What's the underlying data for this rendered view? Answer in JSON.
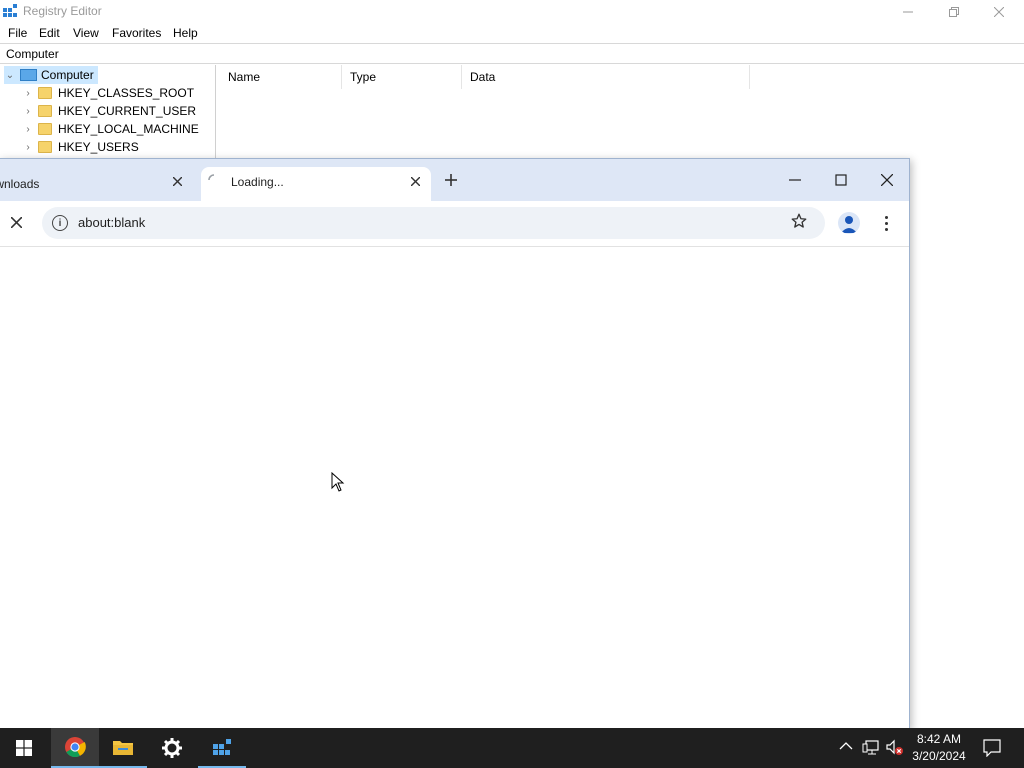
{
  "regedit": {
    "title": "Registry Editor",
    "menu": [
      "File",
      "Edit",
      "View",
      "Favorites",
      "Help"
    ],
    "address": "Computer",
    "tree": {
      "root": "Computer",
      "items": [
        "HKEY_CLASSES_ROOT",
        "HKEY_CURRENT_USER",
        "HKEY_LOCAL_MACHINE",
        "HKEY_USERS"
      ]
    },
    "columns": [
      "Name",
      "Type",
      "Data"
    ]
  },
  "chrome": {
    "tabs": [
      {
        "title": "Downloads"
      },
      {
        "title": "Loading..."
      }
    ],
    "url": "about:blank"
  },
  "taskbar": {
    "time": "8:42 AM",
    "date": "3/20/2024",
    "apps": [
      "start-icon",
      "chrome-icon",
      "file-explorer-icon",
      "settings-icon",
      "registry-editor-icon"
    ]
  },
  "colors": {
    "tabstrip": "#dee7f6",
    "taskbar": "#1f1f1f",
    "accent": "#76b9ed"
  }
}
